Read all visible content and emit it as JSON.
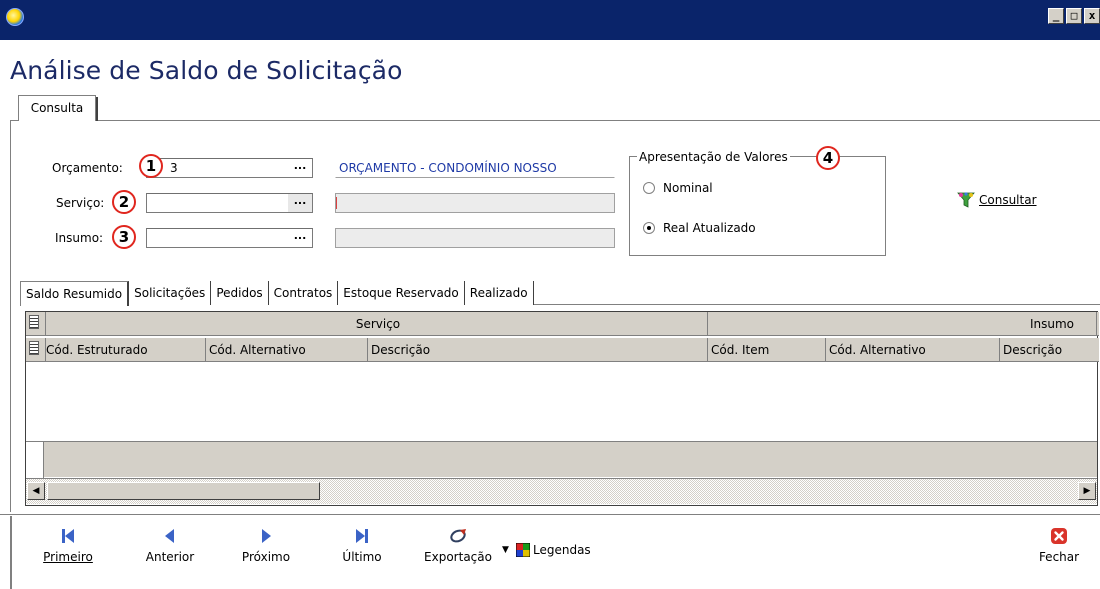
{
  "window": {
    "title_icon": "app-globe-icon",
    "min": "_",
    "max": "□",
    "close": "x"
  },
  "page": {
    "title": "Análise de Saldo de Solicitação"
  },
  "main_tab": {
    "label": "Consulta"
  },
  "form": {
    "orcamento": {
      "label": "Orçamento:",
      "value": "3",
      "button": "...",
      "description": "ORÇAMENTO - CONDOMÍNIO NOSSO",
      "marker": "1"
    },
    "servico": {
      "label": "Serviço:",
      "value": "",
      "button": "...",
      "description": "",
      "marker": "2"
    },
    "insumo": {
      "label": "Insumo:",
      "value": "",
      "button": "...",
      "description": "",
      "marker": "3"
    }
  },
  "valores": {
    "legend": "Apresentação de Valores",
    "marker": "4",
    "options": [
      {
        "label": "Nominal",
        "selected": false
      },
      {
        "label": "Real Atualizado",
        "selected": true
      }
    ]
  },
  "consultar": {
    "label": "Consultar",
    "icon": "funnel-icon"
  },
  "tabs": [
    "Saldo Resumido",
    "Solicitações",
    "Pedidos",
    "Contratos",
    "Estoque Reservado",
    "Realizado"
  ],
  "grid": {
    "group_headers": [
      "Serviço",
      "Insumo"
    ],
    "columns": [
      "Cód. Estruturado",
      "Cód. Alternativo",
      "Descrição",
      "Cód. Item",
      "Cód. Alternativo",
      "Descrição"
    ],
    "rows": []
  },
  "toolbar": {
    "primeiro": "Primeiro",
    "anterior": "Anterior",
    "proximo": "Próximo",
    "ultimo": "Último",
    "exportacao": "Exportação",
    "legendas": "Legendas",
    "fechar": "Fechar"
  },
  "colors": {
    "title_bar": "#0a246a",
    "marker_red": "#e0261e",
    "nav_blue": "#3b63c6",
    "link_blue": "#1f3aa6"
  }
}
